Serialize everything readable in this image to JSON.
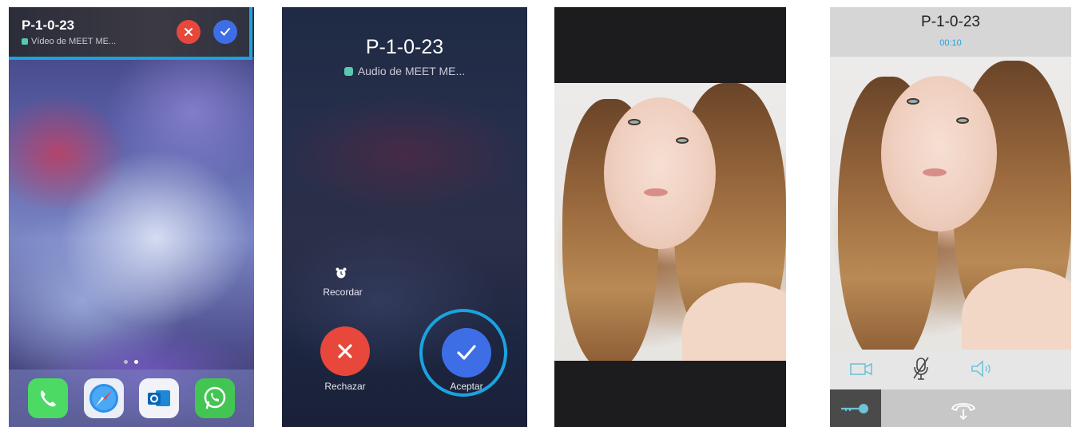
{
  "screen1": {
    "banner": {
      "title": "P-1-0-23",
      "subtitle": "Vídeo de MEET ME..."
    },
    "dock_apps": [
      "phone-icon",
      "safari-icon",
      "outlook-icon",
      "whatsapp-icon"
    ]
  },
  "screen2": {
    "title": "P-1-0-23",
    "subtitle": "Audio de MEET ME...",
    "remind_label": "Recordar",
    "decline_label": "Rechazar",
    "accept_label": "Aceptar"
  },
  "screen4": {
    "title": "P-1-0-23",
    "timer": "00:10"
  },
  "colors": {
    "highlight": "#1aa3e0",
    "decline": "#e8473b",
    "accept": "#3d6ee6",
    "app_accent": "#5ac8b0"
  }
}
